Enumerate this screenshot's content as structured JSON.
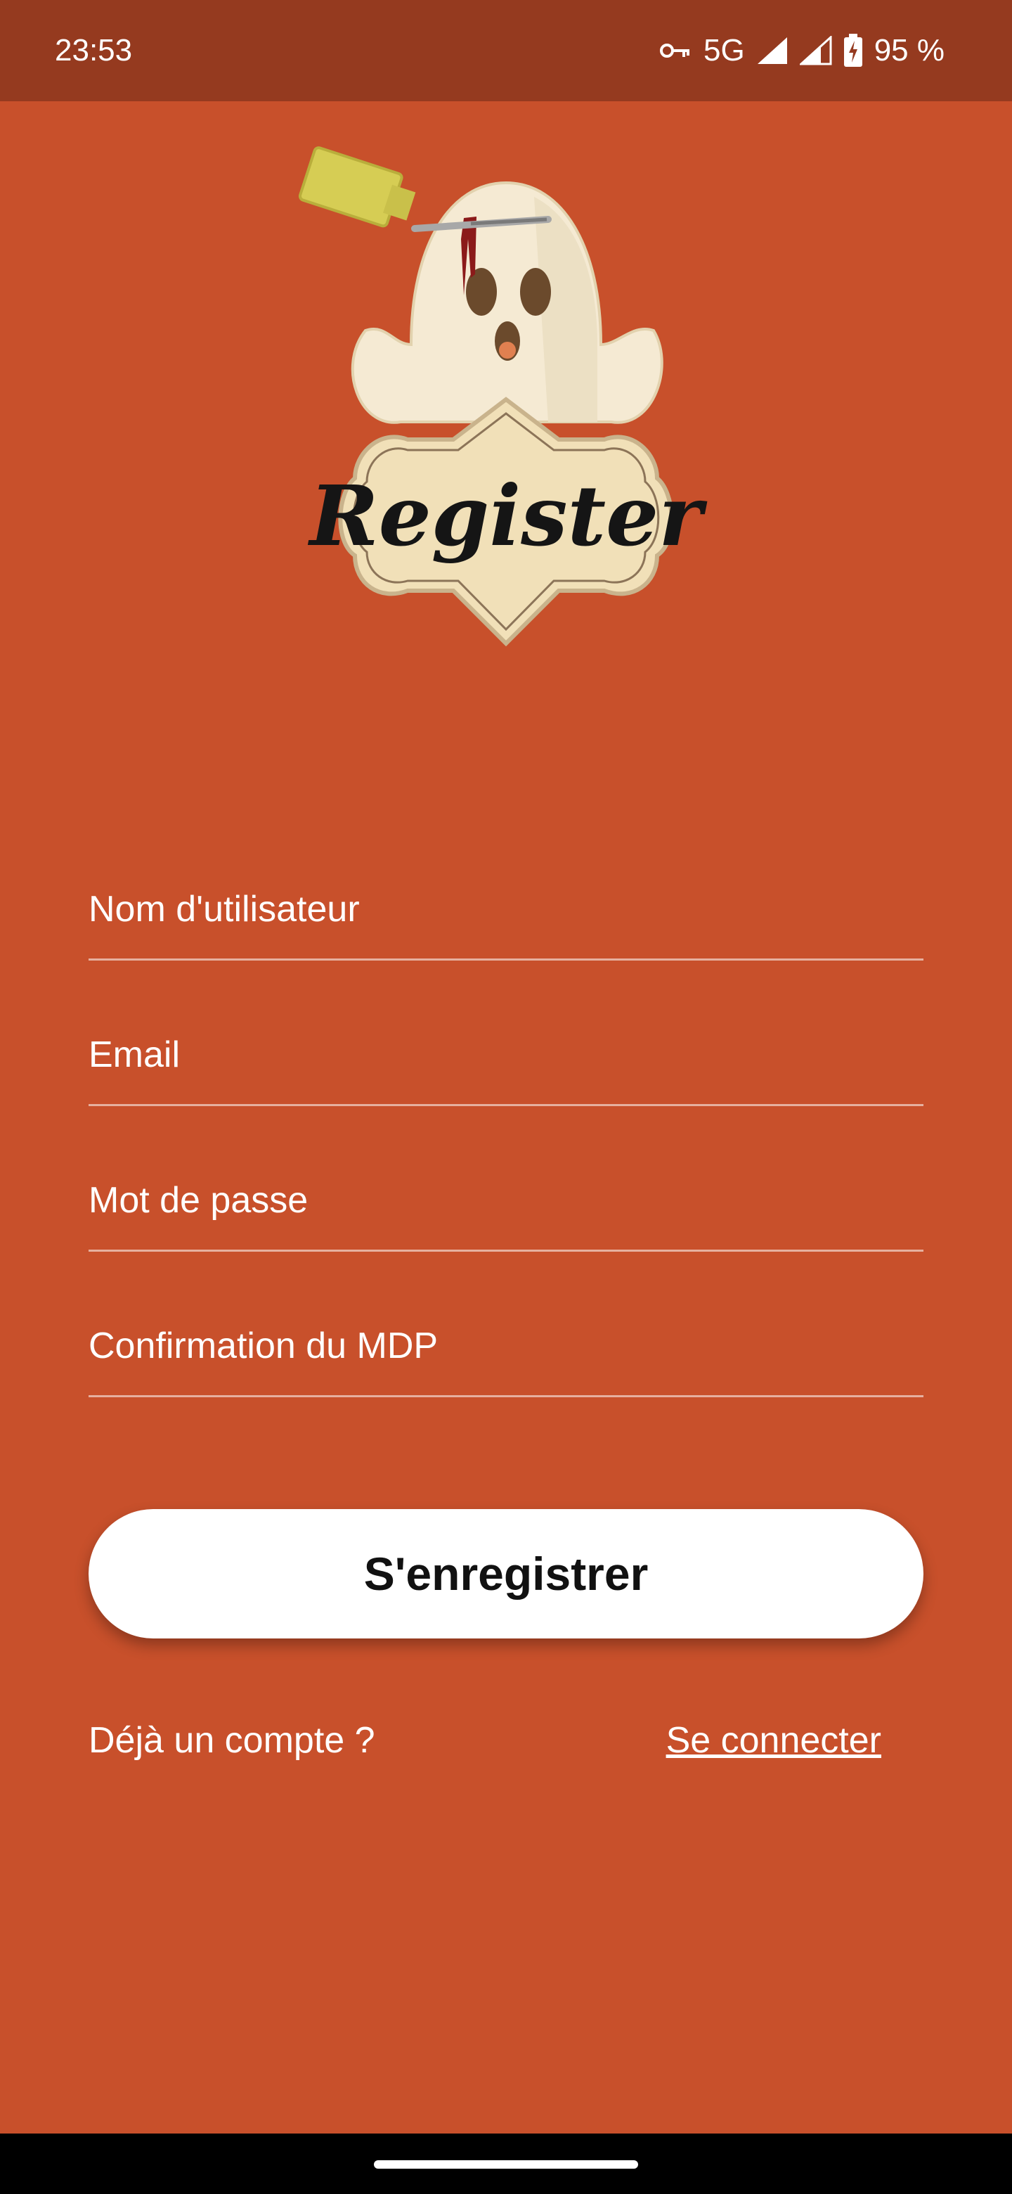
{
  "status_bar": {
    "time": "23:53",
    "network": "5G",
    "battery": "95 %",
    "icons": [
      "key-icon",
      "signal-icon",
      "signal-icon",
      "battery-charging-icon"
    ]
  },
  "logo": {
    "text": "Register",
    "icon": "ghost-with-pushpin"
  },
  "form": {
    "username_placeholder": "Nom d'utilisateur",
    "email_placeholder": "Email",
    "password_placeholder": "Mot de passe",
    "confirm_placeholder": "Confirmation du MDP",
    "submit_label": "S'enregistrer"
  },
  "footer": {
    "prompt": "Déjà un compte ?",
    "link": "Se connecter"
  },
  "colors": {
    "background": "#c8502b",
    "status_bar": "#953a1f",
    "button": "#ffffff"
  }
}
